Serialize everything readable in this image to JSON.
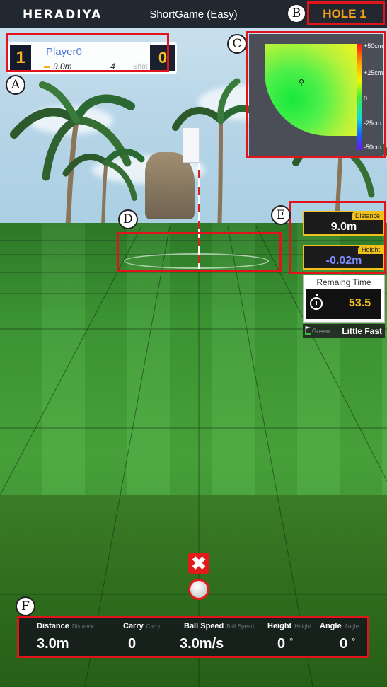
{
  "app": {
    "brand": "HERADIYA",
    "mode_title": "ShortGame (Easy)",
    "hole_label": "HOLE 1"
  },
  "markers": {
    "a": "A",
    "b": "B",
    "c": "C",
    "d": "D",
    "e": "E",
    "f": "F"
  },
  "player": {
    "number": "1",
    "name": "Player0",
    "distance": "9.0m",
    "shot_count": "4",
    "shot_label": "Shot",
    "score": "0"
  },
  "green_map": {
    "scale_labels": [
      "+50cm",
      "+25cm",
      "0",
      "-25cm",
      "-50cm"
    ]
  },
  "stats": {
    "distance_label": "Distance",
    "distance_value": "9.0m",
    "height_label": "Height",
    "height_value": "-0.02m",
    "remaining_label": "Remaing Time",
    "remaining_value": "53.5",
    "green_label": "Green",
    "green_speed": "Little Fast"
  },
  "shot_data": {
    "columns": [
      {
        "label": "Distance",
        "sub": "Distance",
        "value": "3.0m",
        "unit": ""
      },
      {
        "label": "Carry",
        "sub": "Carry",
        "value": "0",
        "unit": ""
      },
      {
        "label": "Ball Speed",
        "sub": "Ball Speed",
        "value": "3.0m/s",
        "unit": ""
      },
      {
        "label": "Height",
        "sub": "Height",
        "value": "0",
        "unit": "°"
      },
      {
        "label": "Angle",
        "sub": "Angle",
        "value": "0",
        "unit": "°"
      }
    ]
  },
  "colors": {
    "accent": "#f5a21a",
    "callout": "#e1141b",
    "player_name": "#4a74d8",
    "height_value": "#7d8cff"
  },
  "icons": {
    "close": "close-icon",
    "ball": "golf-ball-icon",
    "stopwatch": "stopwatch-icon",
    "pin": "pin-icon",
    "green_flag": "flag-icon"
  }
}
